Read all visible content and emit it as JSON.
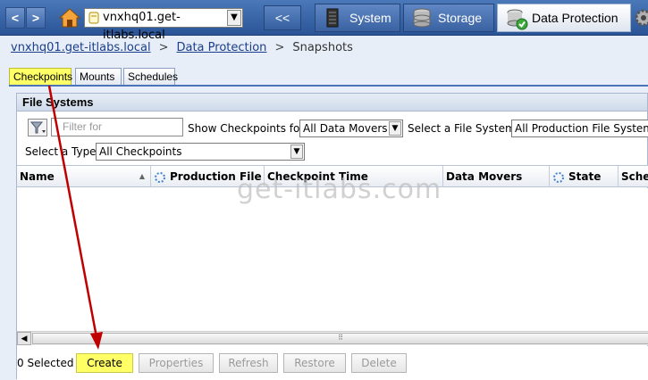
{
  "nav": {
    "back_glyph": "<",
    "forward_glyph": ">",
    "system_select": "vnxhq01.get-itlabs.local",
    "collapse_label": "<<",
    "tabs": [
      {
        "label": "System",
        "icon": "server-icon"
      },
      {
        "label": "Storage",
        "icon": "storage-icon"
      },
      {
        "label": "Data Protection",
        "icon": "data-protection-icon",
        "active": true
      }
    ]
  },
  "breadcrumb": {
    "items": [
      "vnxhq01.get-itlabs.local",
      "Data Protection",
      "Snapshots"
    ],
    "separator": ">"
  },
  "subtabs": [
    "Checkpoints",
    "Mounts",
    "Schedules"
  ],
  "panel": {
    "title": "File Systems",
    "filter_placeholder": "Filter for",
    "show_checkpoints_label": "Show Checkpoints for",
    "data_movers_value": "All Data Movers",
    "select_fs_label": "Select a File System",
    "fs_value": "All Production File Systems",
    "select_type_label": "Select a Type",
    "type_value": "All Checkpoints"
  },
  "grid": {
    "columns": [
      "Name",
      "Production File S...",
      "Checkpoint Time",
      "Data Movers",
      "State",
      "Sched"
    ]
  },
  "footer": {
    "selected_text": "0 Selected",
    "buttons": [
      "Create",
      "Properties",
      "Refresh",
      "Restore",
      "Delete"
    ]
  },
  "watermark": "get-itlabs.com",
  "colors": {
    "highlight": "#ffff66",
    "annotation_arrow": "#c00000",
    "nav_bar": "#3a62a1"
  }
}
